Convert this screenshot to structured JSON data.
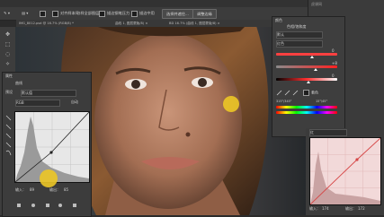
{
  "options": {
    "checkbox1": "对齐样本/取样全部图层",
    "checkbox2": "描边钢笔压力",
    "checkbox3": "描边中用",
    "button1": "选择并遮住...",
    "button2": "调整边缘"
  },
  "doc_tabs": [
    "IMG_8012.psd @ 16.7% (RGB/8) *",
    "曲线 1, 图层蒙版/8) ×",
    "BD 16.7% (曲线 1, 图层蒙版/8) ×"
  ],
  "left_panel": {
    "title": "属性",
    "section": "曲线",
    "preset_label": "预设",
    "preset_value": "默认值",
    "channel_value": "RGB",
    "auto_button": "自动",
    "input_label": "输入：",
    "input_value": "89",
    "output_label": "输出：",
    "output_value": "85"
  },
  "color_panel": {
    "title": "颜色",
    "mode": "色相/饱和度",
    "preset": "默认",
    "channel": "红色",
    "sliders": [
      {
        "value": "0"
      },
      {
        "value": "+8"
      },
      {
        "value": "0"
      }
    ],
    "colorize_label": "着色",
    "range_left": "315°/345°",
    "range_right": "15°\\45°"
  },
  "curves2": {
    "channel": "红",
    "input_label": "输入：",
    "input_value": "174",
    "output_label": "输出：",
    "output_value": "172"
  },
  "colors": {
    "accent": "#e7c428",
    "panel_bg": "#3b3b3b",
    "graph_bg": "#e7e7e7",
    "red_curve": "#d64545"
  },
  "watermark": "虎课网"
}
